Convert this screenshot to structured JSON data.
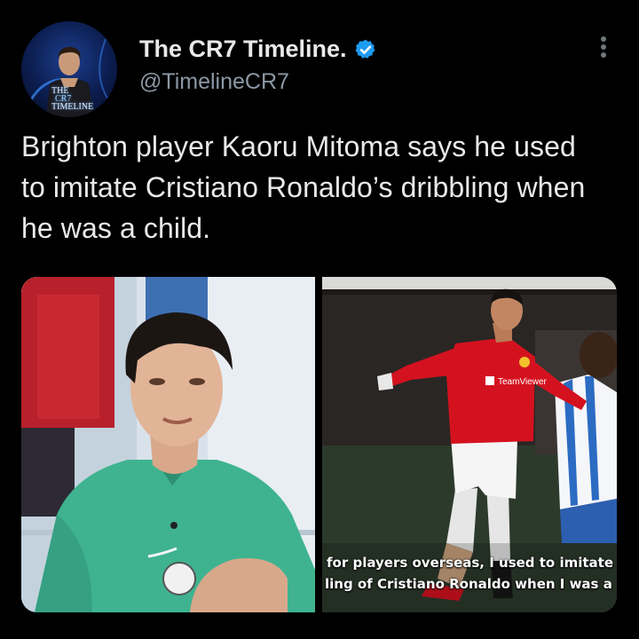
{
  "avatar": {
    "line1": "THE",
    "line2": "CR7",
    "line3": "TIMELINE"
  },
  "account": {
    "display_name": "The CR7 Timeline.",
    "handle": "@TimelineCR7",
    "verified_color": "#1d9bf0"
  },
  "tweet": {
    "text": "Brighton player Kaoru Mitoma says he used to imitate Cristiano Ronaldo’s dribbling when he was a child."
  },
  "media": {
    "subtitle_line1": "for players overseas, I used to imitate",
    "subtitle_line2": "ling of Cristiano Ronaldo when I was a",
    "sponsor_text": "TeamViewer"
  },
  "colors": {
    "background": "#000000",
    "text": "#e7e9ea",
    "secondary_text": "#8b98a5",
    "kit_red": "#d4121f",
    "brighton_teal": "#3fae8f"
  },
  "icons": {
    "verified": "verified-badge-icon",
    "more": "more-options-icon"
  }
}
